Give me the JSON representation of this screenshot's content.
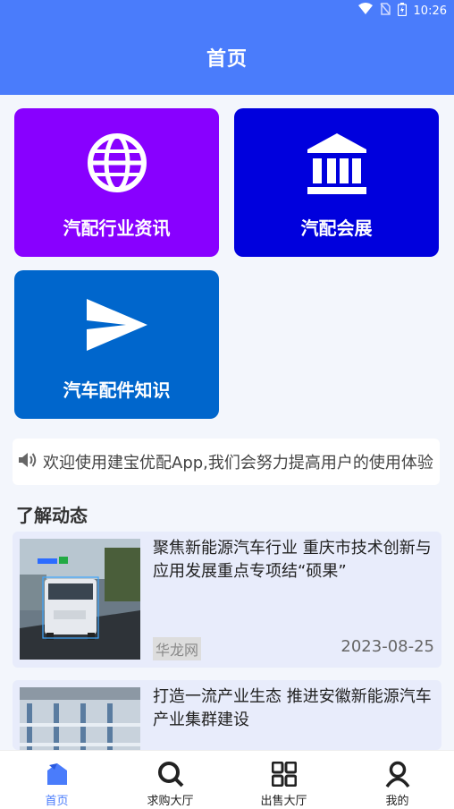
{
  "status_bar": {
    "time": "10:26",
    "icons": [
      "wifi-icon",
      "no-sim-icon",
      "battery-icon"
    ]
  },
  "header": {
    "title": "首页"
  },
  "tiles": [
    {
      "label": "汽配行业资讯",
      "icon": "globe-icon",
      "color": "#8800ff"
    },
    {
      "label": "汽配会展",
      "icon": "bank-icon",
      "color": "#0000dd"
    },
    {
      "label": "汽车配件知识",
      "icon": "send-icon",
      "color": "#0066cc"
    }
  ],
  "notice": {
    "icon": "speaker-icon",
    "text": "欢迎使用建宝优配App,我们会努力提高用户的使用体验"
  },
  "section": {
    "title": "了解动态"
  },
  "news": [
    {
      "title": "聚焦新能源汽车行业 重庆市技术创新与应用发展重点专项结“硕果”",
      "source": "华龙网",
      "date": "2023-08-25"
    },
    {
      "title": "打造一流产业生态 推进安徽新能源汽车产业集群建设"
    }
  ],
  "tabbar": {
    "active_color": "#4a7cfb",
    "items": [
      {
        "label": "首页",
        "icon": "home-icon"
      },
      {
        "label": "求购大厅",
        "icon": "search-icon"
      },
      {
        "label": "出售大厅",
        "icon": "grid-icon"
      },
      {
        "label": "我的",
        "icon": "user-icon"
      }
    ]
  }
}
